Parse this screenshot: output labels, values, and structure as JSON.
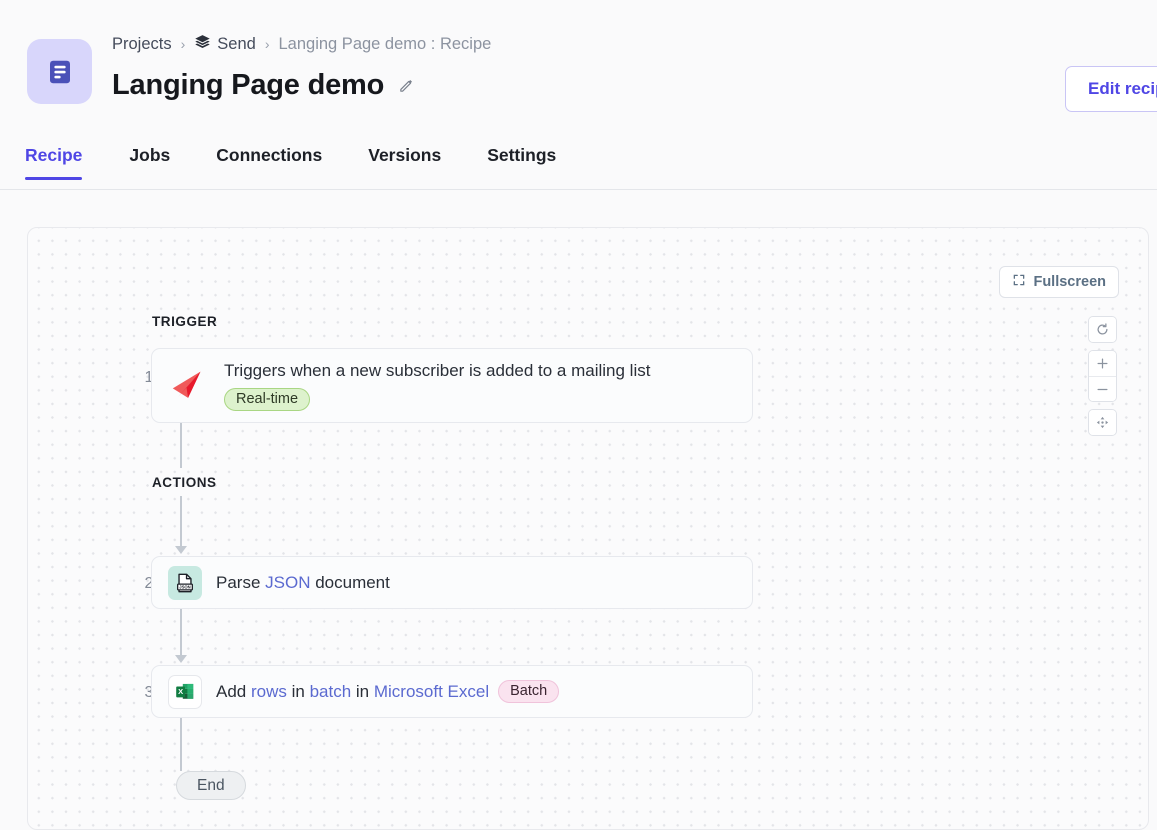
{
  "header": {
    "app_icon": "recipe-document-icon",
    "breadcrumb": [
      {
        "label": "Projects",
        "icon": null
      },
      {
        "label": "Send",
        "icon": "layers-icon"
      },
      {
        "label": "Langing Page demo : Recipe",
        "icon": null
      }
    ],
    "breadcrumb_separator": "›",
    "title": "Langing Page demo",
    "edit_icon": "pencil-icon",
    "edit_recipe_label": "Edit recipe"
  },
  "tabs": [
    {
      "label": "Recipe",
      "active": true
    },
    {
      "label": "Jobs",
      "active": false
    },
    {
      "label": "Connections",
      "active": false
    },
    {
      "label": "Versions",
      "active": false
    },
    {
      "label": "Settings",
      "active": false
    }
  ],
  "canvas": {
    "fullscreen_label": "Fullscreen",
    "fullscreen_icon": "expand-corners-icon",
    "controls": [
      {
        "name": "reset-view",
        "icon": "reset-arrow-icon"
      },
      {
        "name": "zoom-in",
        "icon": "plus-icon"
      },
      {
        "name": "zoom-out",
        "icon": "minus-icon"
      },
      {
        "name": "fit-to-screen",
        "icon": "move-crosshair-icon"
      }
    ],
    "sections": {
      "trigger_label": "TRIGGER",
      "actions_label": "ACTIONS"
    },
    "steps": [
      {
        "number": "1",
        "icon": "paper-plane-icon",
        "text": "Triggers when a new subscriber is added to a mailing list",
        "badge": "Real-time"
      },
      {
        "number": "2",
        "icon": "json-document-icon",
        "text_parts": [
          {
            "t": "Parse ",
            "link": false
          },
          {
            "t": "JSON",
            "link": true
          },
          {
            "t": " document",
            "link": false
          }
        ]
      },
      {
        "number": "3",
        "icon": "microsoft-excel-icon",
        "text_parts": [
          {
            "t": "Add ",
            "link": false
          },
          {
            "t": "rows",
            "link": true
          },
          {
            "t": " in ",
            "link": false
          },
          {
            "t": "batch",
            "link": true
          },
          {
            "t": " in ",
            "link": false
          },
          {
            "t": "Microsoft Excel",
            "link": true
          }
        ],
        "badge": "Batch"
      }
    ],
    "end_label": "End"
  },
  "colors": {
    "accent": "#4f46e5",
    "app_icon_bg": "#d8d6fb",
    "realtime_badge_bg": "#ddf2cd",
    "batch_badge_bg": "#fae3ef",
    "link_text": "#5b6ad0"
  }
}
